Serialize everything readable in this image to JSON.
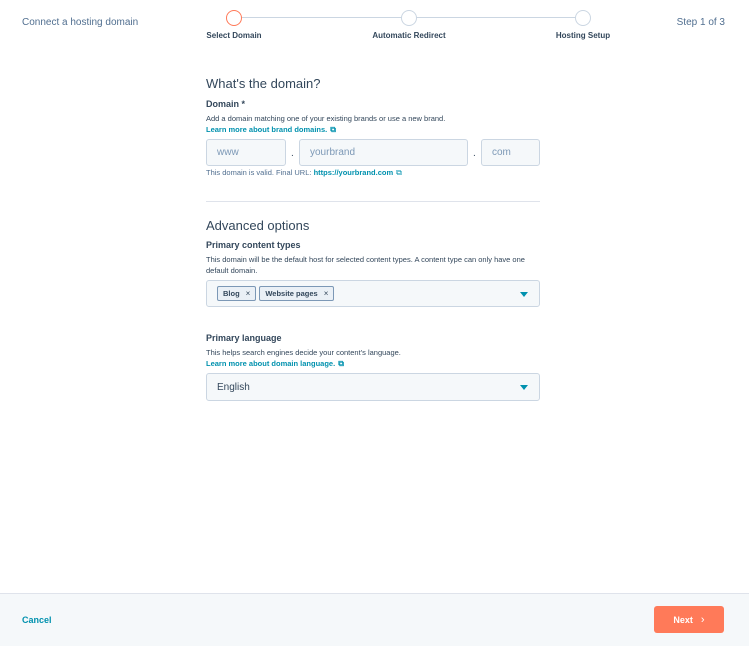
{
  "header": {
    "title": "Connect a hosting domain",
    "step_indicator": "Step 1 of 3",
    "steps": [
      {
        "label": "Select Domain",
        "active": true
      },
      {
        "label": "Automatic Redirect",
        "active": false
      },
      {
        "label": "Hosting Setup",
        "active": false
      }
    ]
  },
  "domain_section": {
    "title": "What's the domain?",
    "label": "Domain *",
    "help": "Add a domain matching one of your existing brands or use a new brand.",
    "link": "Learn more about brand domains.",
    "subdomain_placeholder": "www",
    "brand_placeholder": "yourbrand",
    "tld_placeholder": "com",
    "separator": ".",
    "valid_text": "This domain is valid. Final URL:",
    "final_url": "https://yourbrand.com"
  },
  "advanced": {
    "title": "Advanced options",
    "content_types": {
      "label": "Primary content types",
      "help": "This domain will be the default host for selected content types. A content type can only have one default domain.",
      "tags": [
        "Blog",
        "Website pages"
      ],
      "remove_glyph": "×"
    },
    "language": {
      "label": "Primary language",
      "help": "This helps search engines decide your content's language.",
      "link": "Learn more about domain language.",
      "value": "English"
    }
  },
  "footer": {
    "cancel": "Cancel",
    "next": "Next"
  },
  "icons": {
    "external": "external-link-icon",
    "chevron": "chevron-right-icon",
    "caret": "caret-down-icon"
  },
  "colors": {
    "accent": "#ff7a59",
    "link": "#0091ae",
    "text": "#33475b"
  }
}
